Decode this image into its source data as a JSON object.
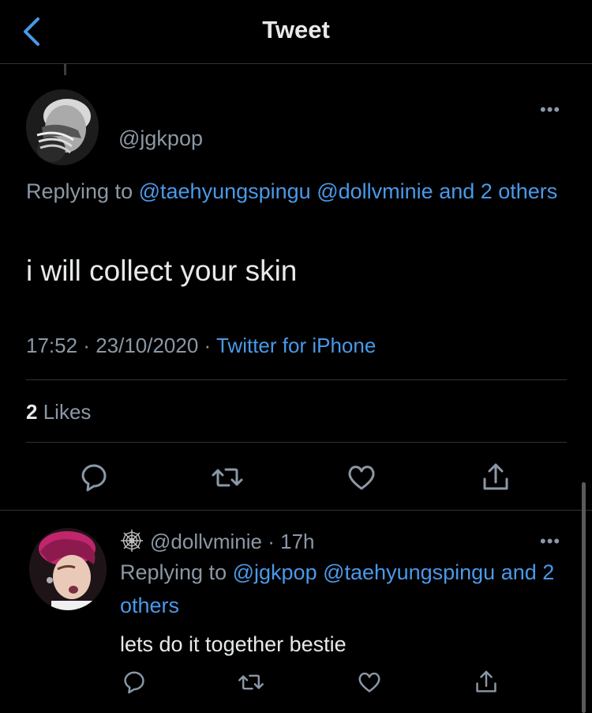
{
  "header": {
    "title": "Tweet"
  },
  "tweet": {
    "handle": "@jgkpop",
    "replying_prefix": "Replying to",
    "replying_mentions": [
      "@taehyungspingu",
      "@dollvminie"
    ],
    "replying_others": "and 2 others",
    "text": "i will collect your skin",
    "time": "17:52",
    "date": "23/10/2020",
    "source": "Twitter for iPhone",
    "likes_count": "2",
    "likes_label": "Likes"
  },
  "reply": {
    "handle": "@dollvminie",
    "age": "17h",
    "replying_prefix": "Replying to",
    "replying_mentions": [
      "@jgkpop",
      "@taehyungspingu"
    ],
    "replying_others": "and 2 others",
    "text": "lets do it together bestie"
  },
  "colors": {
    "link": "#4a99e9",
    "muted": "#8b98a5",
    "text": "#e7e9ea",
    "background": "#000000"
  }
}
